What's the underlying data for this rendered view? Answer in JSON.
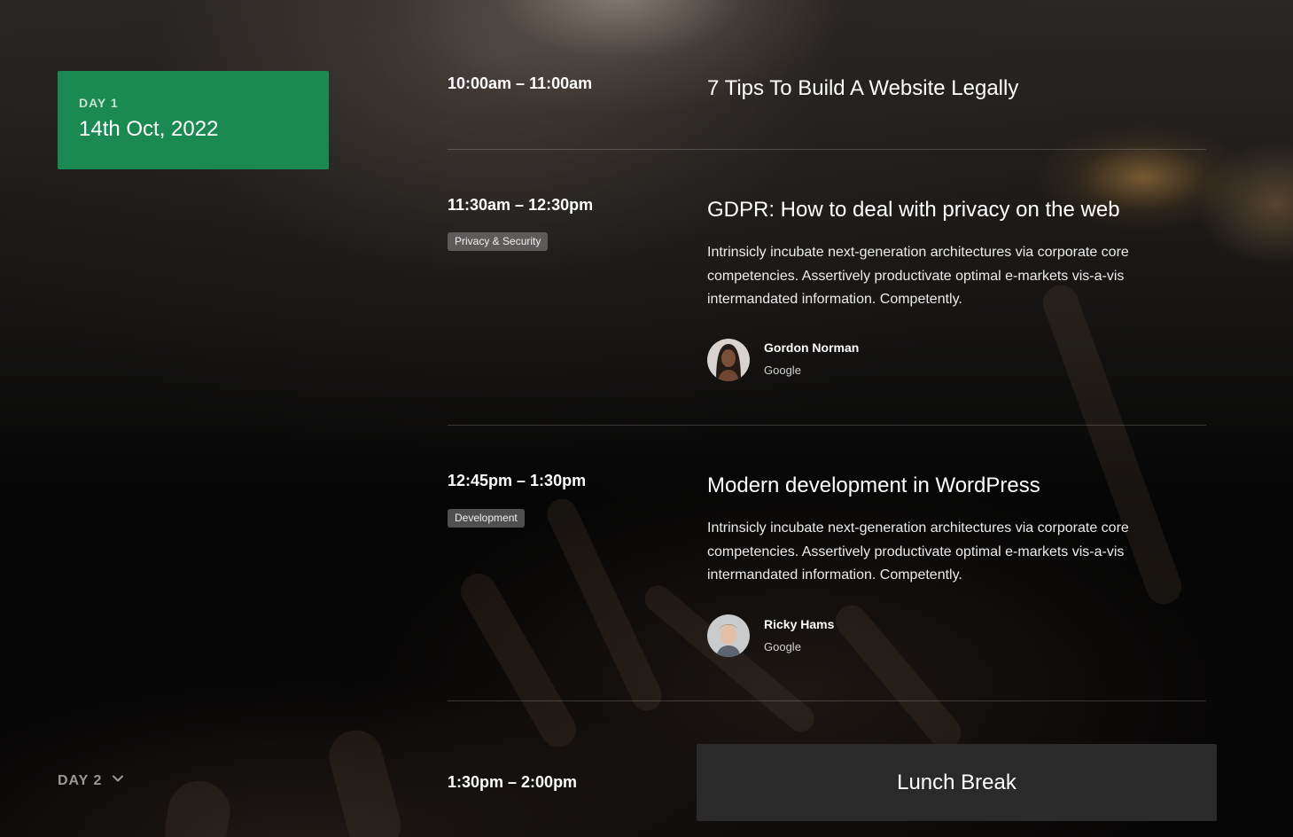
{
  "sidebar": {
    "active_day": {
      "label": "DAY 1",
      "date": "14th Oct, 2022"
    },
    "next_day": {
      "label": "DAY 2"
    }
  },
  "schedule": [
    {
      "time": "10:00am – 11:00am",
      "title": "7 Tips To Build A Website Legally"
    },
    {
      "time": "11:30am – 12:30pm",
      "tag": "Privacy & Security",
      "title": "GDPR: How to deal with privacy on the web",
      "description": "Intrinsicly incubate next-generation architectures via corporate core competencies. Assertively productivate optimal e-markets vis-a-vis intermandated information. Competently.",
      "speaker": {
        "name": "Gordon Norman",
        "company": "Google"
      }
    },
    {
      "time": "12:45pm – 1:30pm",
      "tag": "Development",
      "title": "Modern development in WordPress",
      "description": "Intrinsicly incubate next-generation architectures via corporate core competencies. Assertively productivate optimal e-markets vis-a-vis intermandated information. Competently.",
      "speaker": {
        "name": "Ricky Hams",
        "company": "Google"
      }
    },
    {
      "time": "1:30pm – 2:00pm",
      "title": "Lunch Break"
    }
  ],
  "colors": {
    "day_card": "#1a8a52",
    "lunch_box": "#2a2a2a"
  },
  "icons": {
    "day_toggle": "chevron-down-icon"
  }
}
